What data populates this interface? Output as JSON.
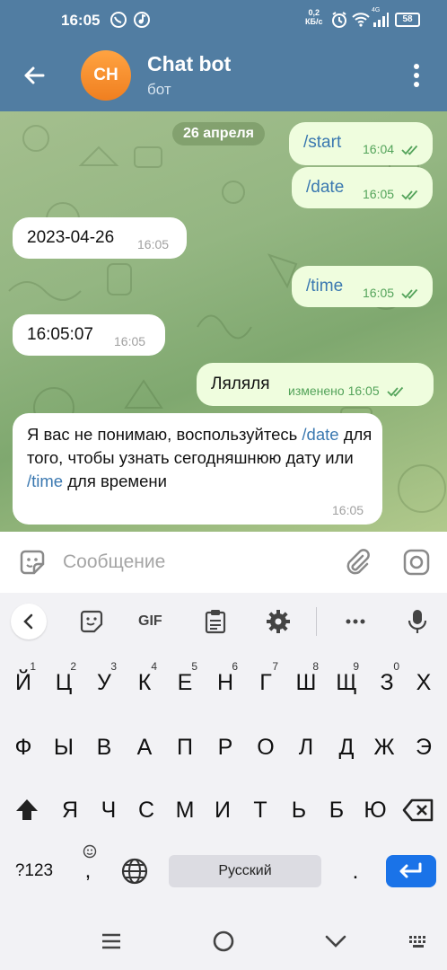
{
  "status_bar": {
    "time": "16:05",
    "net_speed": "0,2",
    "net_unit": "КБ/с",
    "network_type": "4G",
    "battery": "58"
  },
  "header": {
    "avatar_initials": "CH",
    "title": "Chat bot",
    "subtitle": "бот",
    "accent_color": "#517da2"
  },
  "chat": {
    "date_chip": "26 апреля",
    "messages": [
      {
        "direction": "out",
        "text": "/start",
        "time": "16:04"
      },
      {
        "direction": "out",
        "text": "/date",
        "time": "16:05"
      },
      {
        "direction": "in",
        "text": "2023-04-26",
        "time": "16:05"
      },
      {
        "direction": "out",
        "text": "/time",
        "time": "16:05"
      },
      {
        "direction": "in",
        "text": "16:05:07",
        "time": "16:05"
      },
      {
        "direction": "out",
        "text": "Ляляля",
        "edited_label": "изменено",
        "time": "16:05"
      },
      {
        "direction": "in",
        "text_parts": [
          "Я вас не понимаю, воспользуйтесь ",
          "/date",
          " для того, чтобы узнать сегодняшнюю дату или ",
          "/time",
          " для времени"
        ],
        "time": "16:05"
      }
    ]
  },
  "input_bar": {
    "placeholder": "Сообщение"
  },
  "keyboard": {
    "toolbar_gif_label": "GIF",
    "row1": [
      "Й",
      "Ц",
      "У",
      "К",
      "Е",
      "Н",
      "Г",
      "Ш",
      "Щ",
      "З",
      "Х"
    ],
    "row1_numbers": [
      "1",
      "2",
      "3",
      "4",
      "5",
      "6",
      "7",
      "8",
      "9",
      "0"
    ],
    "row2": [
      "Ф",
      "Ы",
      "В",
      "А",
      "П",
      "Р",
      "О",
      "Л",
      "Д",
      "Ж",
      "Э"
    ],
    "row3": [
      "Я",
      "Ч",
      "С",
      "М",
      "И",
      "Т",
      "Ь",
      "Б",
      "Ю"
    ],
    "symbols_key": "?123",
    "comma_key": ",",
    "space_label": "Русский",
    "period_key": "."
  }
}
